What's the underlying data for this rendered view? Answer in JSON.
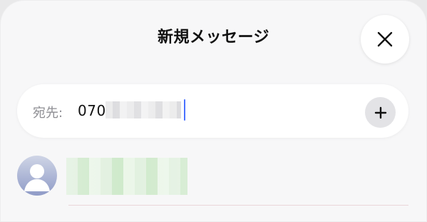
{
  "header": {
    "title": "新規メッセージ"
  },
  "recipient_field": {
    "label": "宛先:",
    "value": "070"
  },
  "colors": {
    "caret": "#4a72ff",
    "avatar_top": "#cfd5e6",
    "avatar_bottom": "#8f9bc7"
  },
  "icons": {
    "close": "close-icon",
    "add": "plus-icon",
    "avatar": "person-icon"
  }
}
